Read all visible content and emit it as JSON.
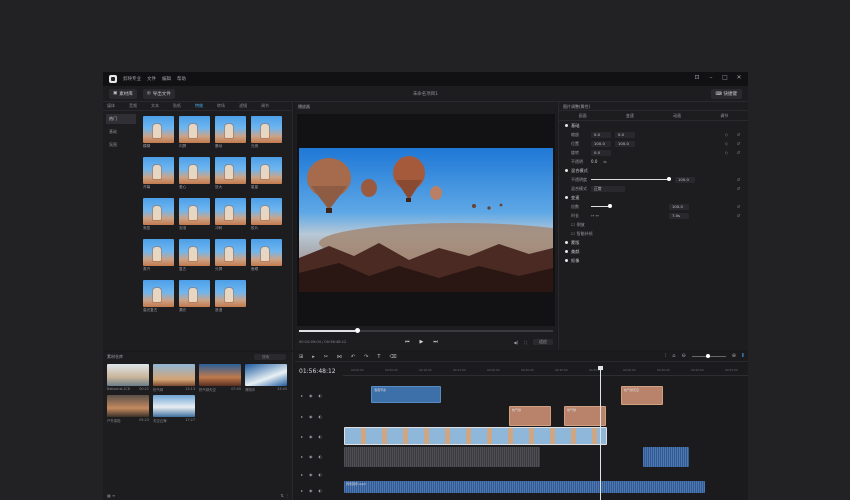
{
  "titlebar": {
    "app_name": "剪映专业",
    "menus": [
      "文件",
      "编辑",
      "帮助"
    ],
    "controls": [
      "⊡",
      "–",
      "□",
      "✕"
    ]
  },
  "toolbar": {
    "import_label": "素材库",
    "export_label": "导出文件",
    "project_title": "未命名项目1",
    "share_label": "快捷键"
  },
  "media": {
    "tabs": [
      "媒体",
      "音频",
      "文本",
      "贴纸",
      "特效",
      "转场",
      "滤镜",
      "调节"
    ],
    "active_tab": 4,
    "categories": [
      "热门",
      "基础",
      "氛围"
    ],
    "active_category": 0,
    "items": [
      "模糊",
      "闪屏",
      "震动",
      "光斑",
      "开幕",
      "爱心",
      "放大",
      "星星",
      "渐显",
      "泡泡",
      "冲刺",
      "胶片",
      "蒸汽",
      "复古",
      "分屏",
      "鱼眼",
      "高光复古",
      "漏光",
      "浪漫"
    ]
  },
  "preview": {
    "header": "播放器",
    "timecode": "00:10:09:04 / 00:56:48:12",
    "zoom": "适应",
    "progress": 0.22
  },
  "properties": {
    "header": "图片调整(属性)",
    "tabs": [
      "画面",
      "变速",
      "动画",
      "调节"
    ],
    "sections": {
      "basic": "基础",
      "blend": "混合模式",
      "speed": "变速"
    },
    "rows": {
      "scale_label": "缩放",
      "scale_val": "0.0",
      "scale_val2": "0.0",
      "position_label": "位置",
      "pos_x": "100.0",
      "pos_y": "100.0",
      "rotate_label": "旋转",
      "rotate_val": "0.0",
      "opacity_label": "不透明",
      "opacity_val": "0.0",
      "blend_opacity_label": "不透明度",
      "blend_opacity_val": "100.0",
      "blend_mode_label": "混合模式",
      "blend_mode_val": "正常",
      "speed_label": "倍数",
      "speed_val": "100.0",
      "duration_label": "时长",
      "duration_val": "7.0s",
      "reverse_label": "倒放",
      "smooth_label": "智能补帧"
    },
    "more_sections": [
      "蒙版",
      "美颜",
      "抠像"
    ]
  },
  "library": {
    "header": "素材仓库",
    "search_placeholder": "搜索",
    "items": [
      {
        "name": "BalloonsL1C8",
        "dur": "00:21"
      },
      {
        "name": "热气球",
        "dur": "13:13"
      },
      {
        "name": "热气球天空",
        "dur": "07:45"
      },
      {
        "name": "滑翔伞",
        "dur": "33:45"
      },
      {
        "name": "户外探险",
        "dur": "05:23"
      },
      {
        "name": "天空云海",
        "dur": "17:27"
      }
    ]
  },
  "timeline": {
    "current_time": "01:56:48:12",
    "tools": [
      "⊞",
      "▸",
      "✂",
      "⋈",
      "↶",
      "↷",
      "T",
      "⌫"
    ],
    "ticks": [
      "00:00:00",
      "00:05:00",
      "00:10:00",
      "00:15:00",
      "00:20:00",
      "00:25:00",
      "00:30:00",
      "00:35:00",
      "00:40:00",
      "00:45:00",
      "00:50:00",
      "00:55:00"
    ],
    "clips": {
      "text1": "泡泡节奏",
      "tan1": "热气球",
      "tan2": "热气球",
      "tan3": "热气球天空",
      "audio": "背景音乐.mp3"
    }
  }
}
